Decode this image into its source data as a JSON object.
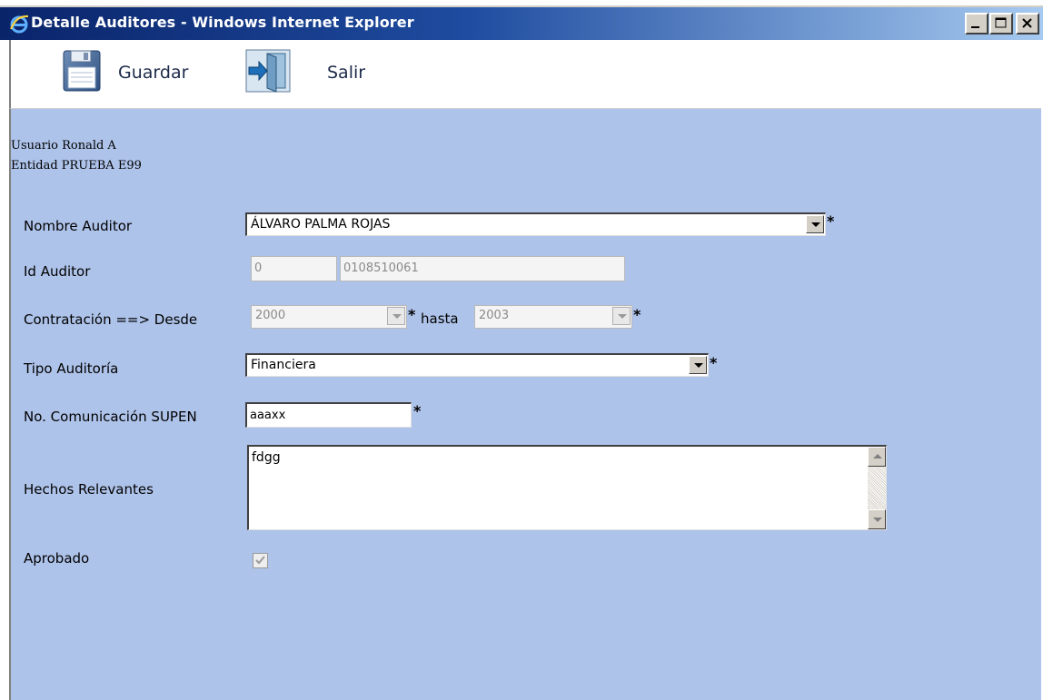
{
  "window": {
    "title": "Detalle Auditores - Windows Internet Explorer"
  },
  "toolbar": {
    "save_label": "Guardar",
    "exit_label": "Salir"
  },
  "user_info": {
    "user_line": "Usuario Ronald A",
    "entity_line": "Entidad PRUEBA E99"
  },
  "form": {
    "nombre_auditor": {
      "label": "Nombre Auditor",
      "value": "ÁLVARO PALMA ROJAS"
    },
    "id_auditor": {
      "label": "Id Auditor",
      "value_type": "0",
      "value_id": "0108510061"
    },
    "contratacion": {
      "label": "Contratación ==> Desde",
      "desde": "2000",
      "hasta_label": "hasta",
      "hasta": "2003"
    },
    "tipo_auditoria": {
      "label": "Tipo Auditoría",
      "value": "Financiera"
    },
    "no_comunicacion": {
      "label": "No. Comunicación SUPEN",
      "value": "aaaxx"
    },
    "hechos_relevantes": {
      "label": "Hechos Relevantes",
      "value": "fdgg"
    },
    "aprobado": {
      "label": "Aprobado",
      "checked": true
    },
    "required_marker": "*"
  }
}
